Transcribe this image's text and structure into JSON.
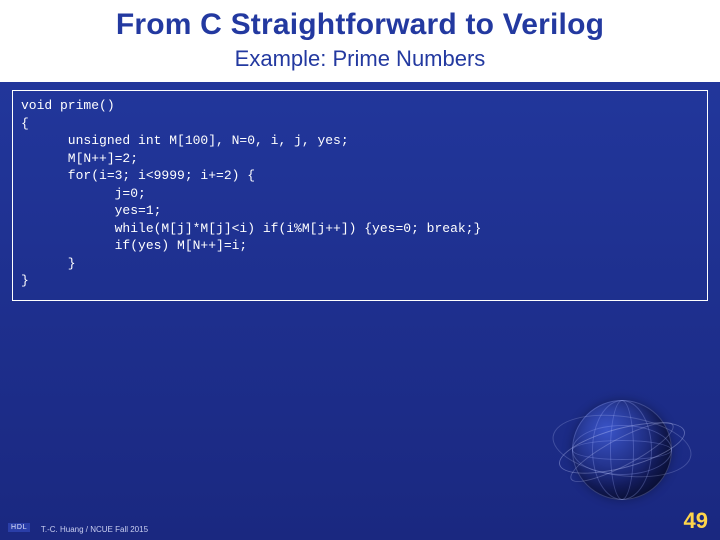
{
  "title": "From C Straightforward to Verilog",
  "subtitle": "Example: Prime Numbers",
  "code": "void prime()\n{\n      unsigned int M[100], N=0, i, j, yes;\n      M[N++]=2;\n      for(i=3; i<9999; i+=2) {\n            j=0;\n            yes=1;\n            while(M[j]*M[j]<i) if(i%M[j++]) {yes=0; break;}\n            if(yes) M[N++]=i;\n      }\n}",
  "footer": {
    "box": "HDL",
    "credit": "T.-C. Huang / NCUE  Fall 2015",
    "page": "49"
  }
}
